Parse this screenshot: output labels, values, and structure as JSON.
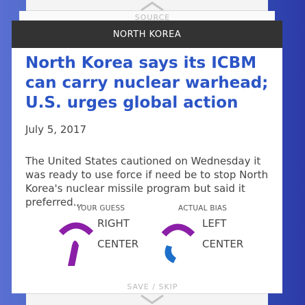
{
  "nav": {
    "prev_label": "SOURCE",
    "next_label": "SAVE / SKIP"
  },
  "article": {
    "topic": "NORTH KOREA",
    "headline": "North Korea says its ICBM can carry nuclear warhead; U.S. urges global action",
    "date": "July 5, 2017",
    "summary": "The United States cautioned on Wednesday it was ready to use force if need be to stop North Korea's nuclear missile program but said it preferred..."
  },
  "guess": {
    "label": "YOUR GUESS",
    "line1": "RIGHT",
    "line2": "CENTER"
  },
  "actual": {
    "label": "ACTUAL BIAS",
    "line1": "LEFT",
    "line2": "CENTER"
  },
  "colors": {
    "headline": "#2b55c6",
    "topic_bar": "#333333",
    "guess_gauge": "#8b1fa8",
    "actual_gauge": "#1d6fc9"
  }
}
